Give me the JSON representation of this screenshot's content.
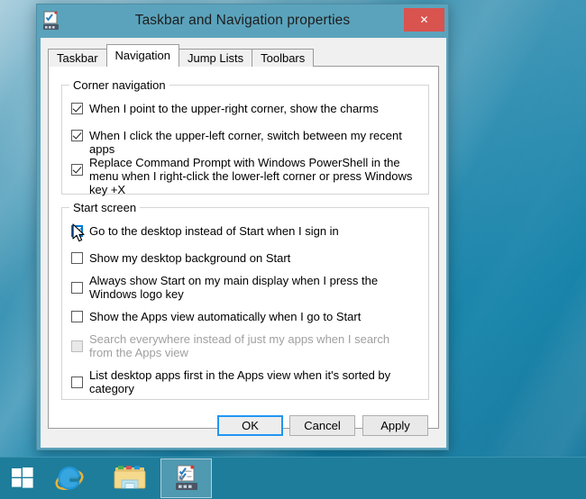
{
  "window": {
    "title": "Taskbar and Navigation properties",
    "icon": "taskbar-properties-icon",
    "close_label": "✕",
    "titlebar_color": "#5ba3bc",
    "close_color": "#d9534f"
  },
  "tabs": [
    {
      "label": "Taskbar",
      "active": false
    },
    {
      "label": "Navigation",
      "active": true
    },
    {
      "label": "Jump Lists",
      "active": false
    },
    {
      "label": "Toolbars",
      "active": false
    }
  ],
  "groups": [
    {
      "legend": "Corner navigation",
      "options": [
        {
          "label": "When I point to the upper-right corner, show the charms",
          "checked": true,
          "disabled": false,
          "focused": false
        },
        {
          "label": "When I click the upper-left corner, switch between my recent apps",
          "checked": true,
          "disabled": false,
          "focused": false
        },
        {
          "label": "Replace Command Prompt with Windows PowerShell in the menu when I right-click the lower-left corner or press Windows key +X",
          "checked": true,
          "disabled": false,
          "focused": false
        }
      ]
    },
    {
      "legend": "Start screen",
      "options": [
        {
          "label": "Go to the desktop instead of Start when I sign in",
          "checked": true,
          "disabled": false,
          "focused": true
        },
        {
          "label": "Show my desktop background on Start",
          "checked": false,
          "disabled": false,
          "focused": false
        },
        {
          "label": "Always show Start on my main display when I press the Windows logo key",
          "checked": false,
          "disabled": false,
          "focused": false
        },
        {
          "label": "Show the Apps view automatically when I go to Start",
          "checked": false,
          "disabled": false,
          "focused": false
        },
        {
          "label": "Search everywhere instead of just my apps when I search from the Apps view",
          "checked": false,
          "disabled": true,
          "focused": false
        },
        {
          "label": "List desktop apps first in the Apps view when it's sorted by category",
          "checked": false,
          "disabled": false,
          "focused": false
        }
      ]
    }
  ],
  "buttons": {
    "ok": "OK",
    "cancel": "Cancel",
    "apply": "Apply",
    "default_button": "OK",
    "focus_color": "#2196f3"
  },
  "taskbar": {
    "background": "#1e7d9b",
    "items": [
      {
        "name": "start-button",
        "icon": "windows-logo-icon"
      },
      {
        "name": "internet-explorer",
        "icon": "internet-explorer-icon"
      },
      {
        "name": "file-explorer",
        "icon": "file-explorer-icon"
      },
      {
        "name": "taskbar-properties",
        "icon": "taskbar-properties-icon",
        "active": true
      }
    ]
  },
  "desktop": {
    "background_color": "#2b8cb0"
  }
}
